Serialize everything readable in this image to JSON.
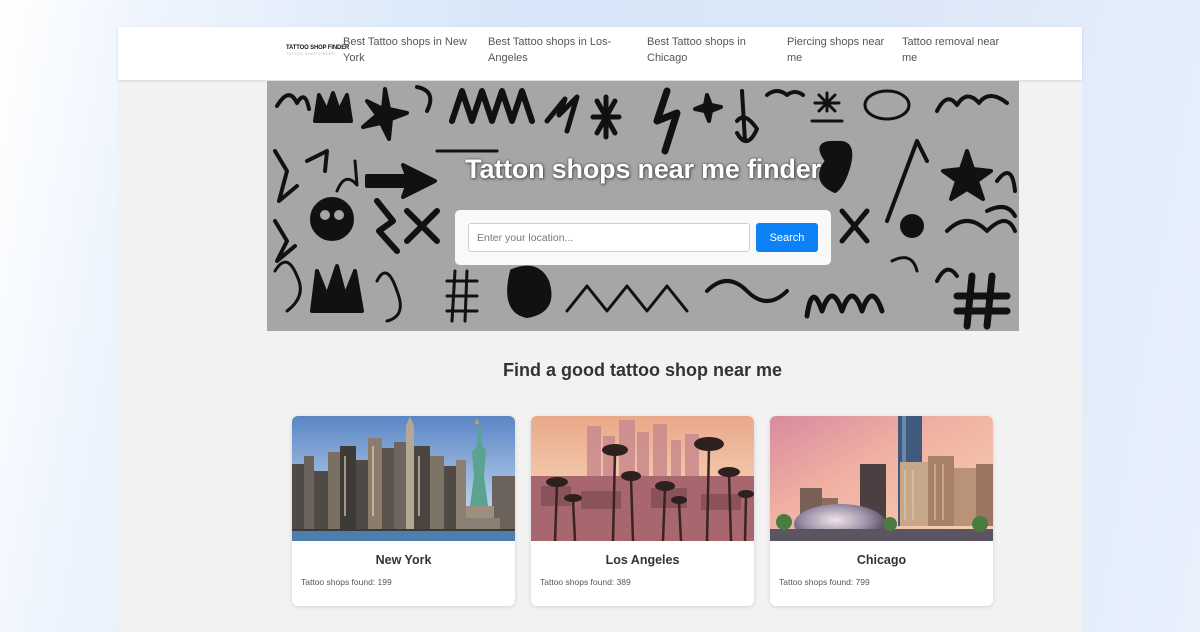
{
  "logo": {
    "main": "TATTOO SHOP FINDER",
    "sub": "TATTOO SHOP FINDER"
  },
  "nav": {
    "links": [
      {
        "line1": "Best Tattoo shops in New",
        "line2": "York"
      },
      {
        "line1": "Best Tattoo shops in Los-",
        "line2": "Angeles"
      },
      {
        "line1": "Best Tattoo shops in",
        "line2": "Chicago"
      },
      {
        "line1": "Piercing shops near",
        "line2": "me"
      },
      {
        "line1": "Tattoo removal near",
        "line2": "me"
      }
    ]
  },
  "hero": {
    "title": "Tatton shops near me finder",
    "search_placeholder": "Enter your location...",
    "search_button": "Search"
  },
  "section": {
    "title": "Find a good tattoo shop near me"
  },
  "cards": [
    {
      "city": "New York",
      "count_label": "Tattoo shops found: 199"
    },
    {
      "city": "Los Angeles",
      "count_label": "Tattoo shops found: 389"
    },
    {
      "city": "Chicago",
      "count_label": "Tattoo shops found: 799"
    }
  ]
}
